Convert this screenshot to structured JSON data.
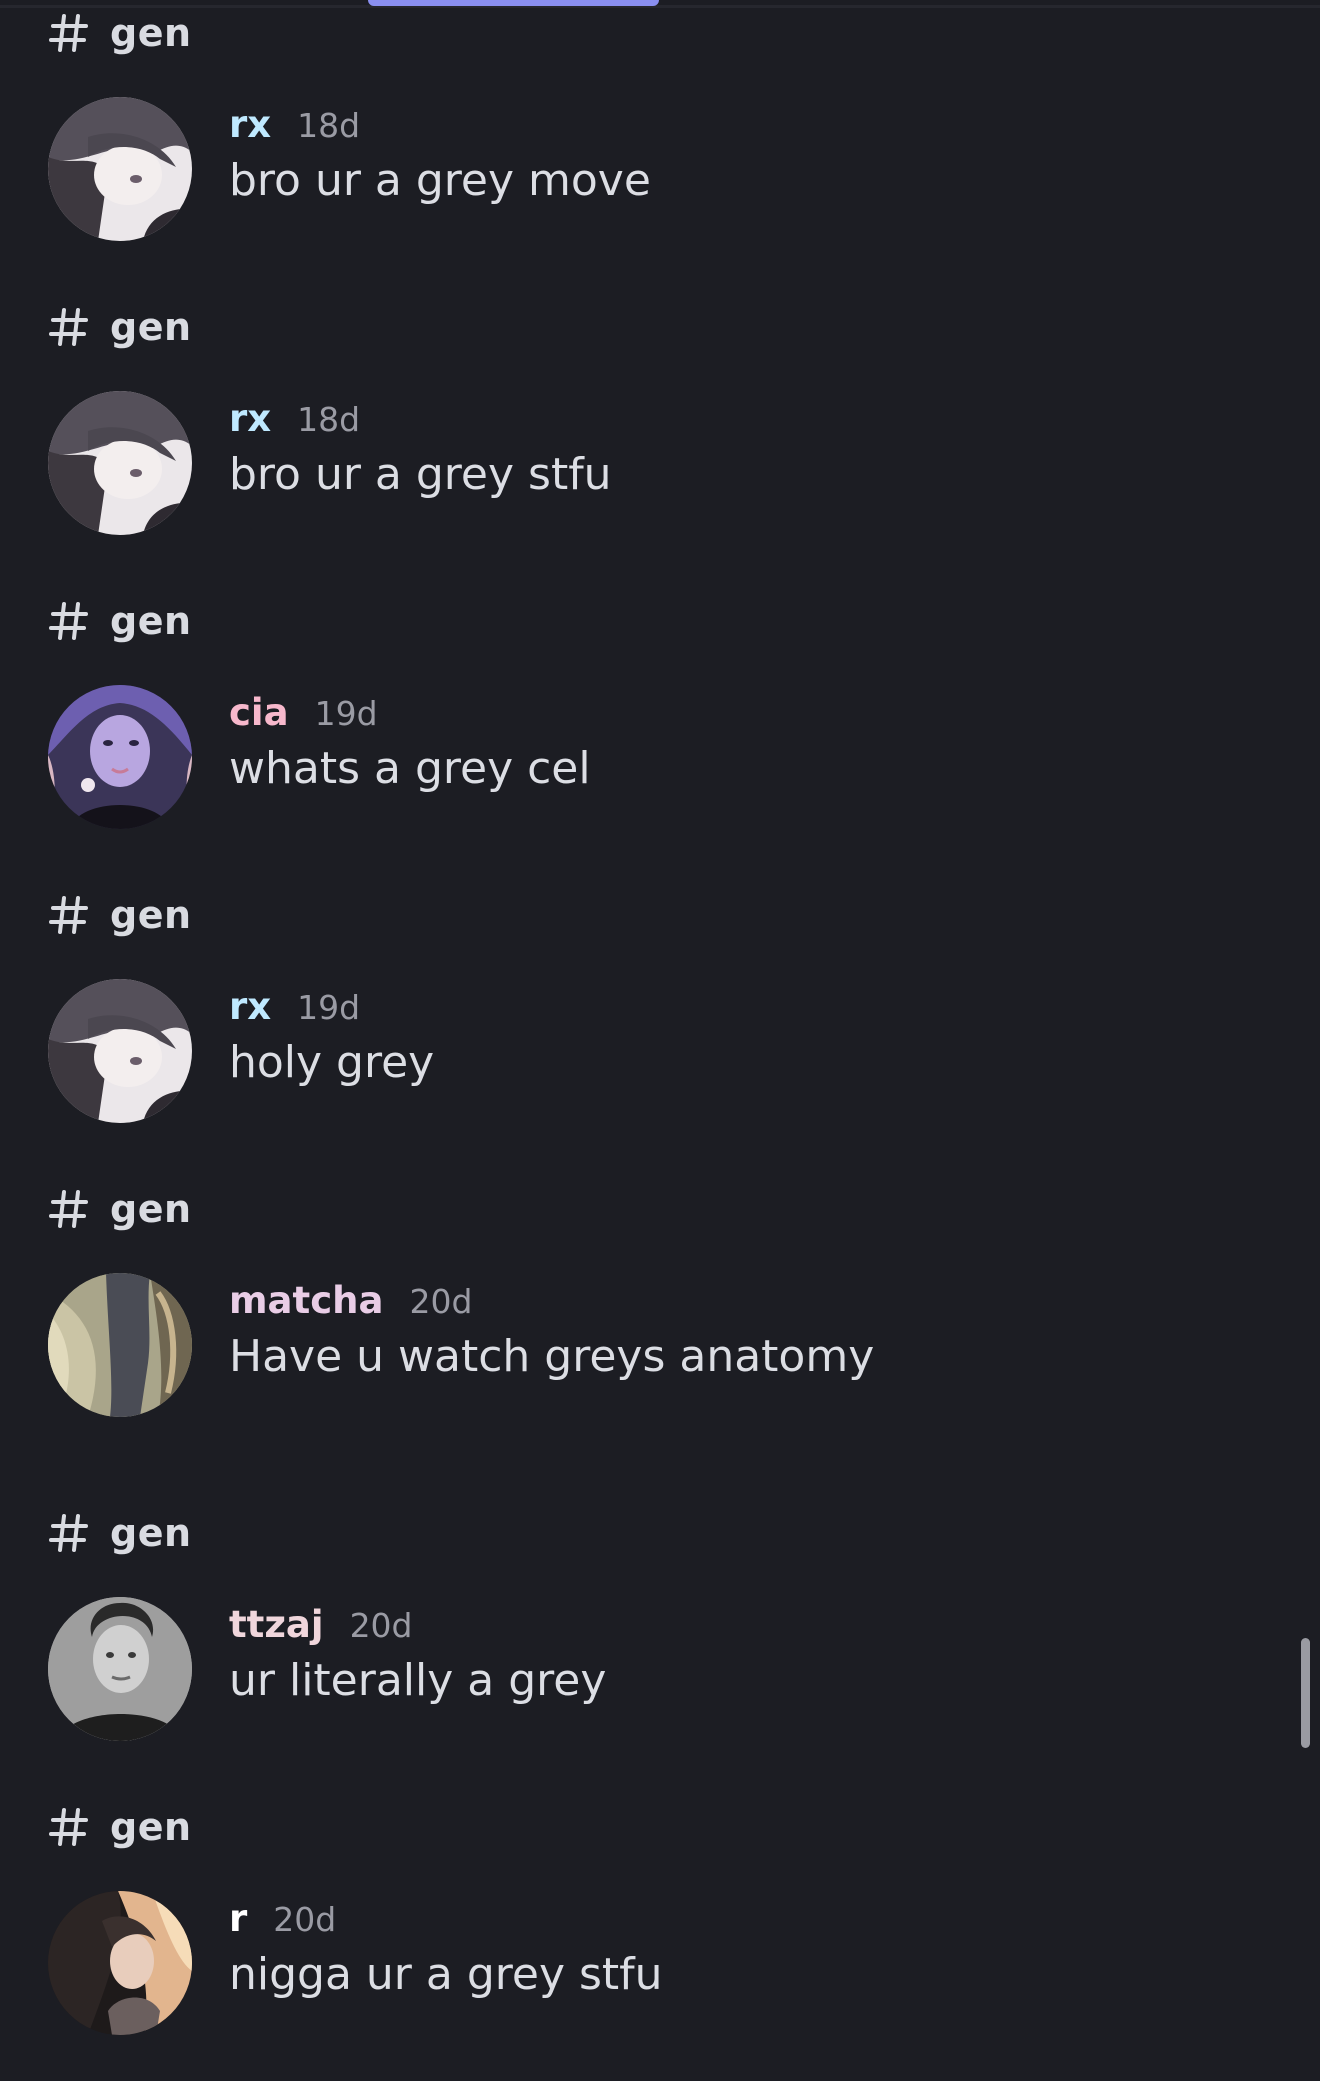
{
  "channel_icon": "hash-icon",
  "colors": {
    "background": "#1c1d23",
    "message_text": "#dcdee4",
    "timestamp": "#9a9ba4",
    "tab_indicator": "#8a8ff0"
  },
  "feed": [
    {
      "channel": "gen",
      "username": "rx",
      "username_color": "#bfe9ff",
      "time": "18d",
      "text": "bro ur a grey move"
    },
    {
      "channel": "gen",
      "username": "rx",
      "username_color": "#bfe9ff",
      "time": "18d",
      "text": "bro ur a grey stfu"
    },
    {
      "channel": "gen",
      "username": "cia",
      "username_color": "#f7b8cc",
      "time": "19d",
      "text": "whats a grey cel"
    },
    {
      "channel": "gen",
      "username": "rx",
      "username_color": "#bfe9ff",
      "time": "19d",
      "text": "holy grey"
    },
    {
      "channel": "gen",
      "username": "matcha",
      "username_color": "#e9cde6",
      "time": "20d",
      "text": "Have u watch greys anatomy"
    },
    {
      "channel": "gen",
      "username": "ttzaj",
      "username_color": "#f0d6dc",
      "time": "20d",
      "text": "ur literally a grey"
    },
    {
      "channel": "gen",
      "username": "r",
      "username_color": "#ffffff",
      "time": "20d",
      "text": "nigga ur a grey stfu"
    }
  ]
}
